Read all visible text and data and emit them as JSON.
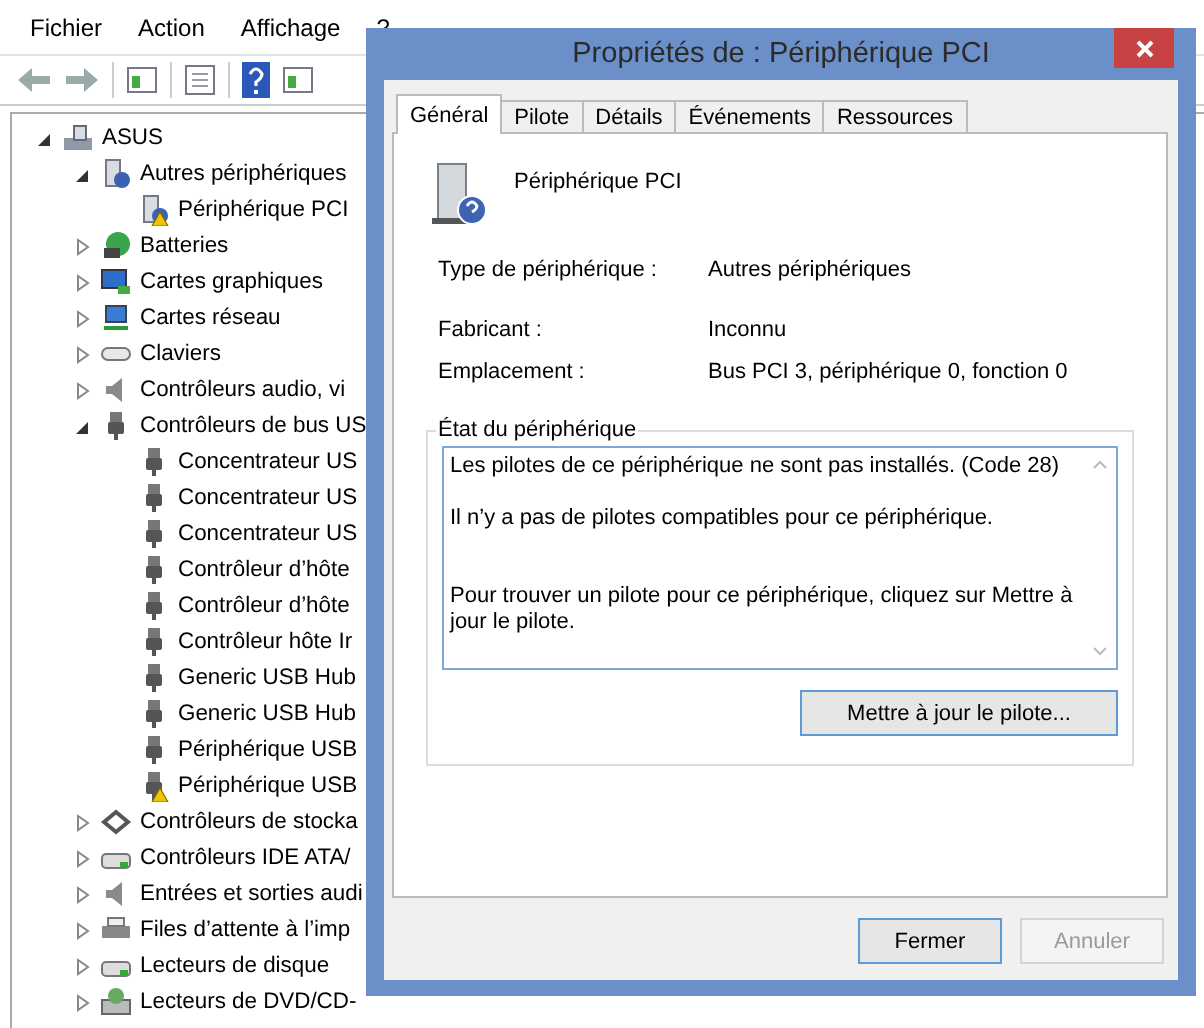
{
  "menu": [
    "Fichier",
    "Action",
    "Affichage",
    "?"
  ],
  "tree": [
    {
      "label": "ASUS",
      "kind": "computer",
      "expanded": true,
      "children": [
        {
          "label": "Autres périphériques",
          "kind": "unknown",
          "expanded": true,
          "children": [
            {
              "label": "Périphérique PCI",
              "kind": "unknown",
              "warning": true
            }
          ]
        },
        {
          "label": "Batteries",
          "kind": "battery",
          "expanded": false
        },
        {
          "label": "Cartes graphiques",
          "kind": "display",
          "expanded": false
        },
        {
          "label": "Cartes réseau",
          "kind": "network",
          "expanded": false
        },
        {
          "label": "Claviers",
          "kind": "keyboard",
          "expanded": false
        },
        {
          "label": "Contrôleurs audio, vi",
          "kind": "audio",
          "expanded": false
        },
        {
          "label": "Contrôleurs de bus US",
          "kind": "usb",
          "expanded": true,
          "children": [
            {
              "label": "Concentrateur US",
              "kind": "usb",
              "warning": false
            },
            {
              "label": "Concentrateur US",
              "kind": "usb",
              "warning": false
            },
            {
              "label": "Concentrateur US",
              "kind": "usb",
              "warning": false
            },
            {
              "label": "Contrôleur d’hôte",
              "kind": "usb",
              "warning": false
            },
            {
              "label": "Contrôleur d’hôte",
              "kind": "usb",
              "warning": false
            },
            {
              "label": "Contrôleur hôte Ir",
              "kind": "usb",
              "warning": false
            },
            {
              "label": "Generic USB Hub",
              "kind": "usb",
              "warning": false
            },
            {
              "label": "Generic USB Hub",
              "kind": "usb",
              "warning": false
            },
            {
              "label": "Périphérique USB",
              "kind": "usb",
              "warning": false
            },
            {
              "label": "Périphérique USB",
              "kind": "usb",
              "warning": true
            }
          ]
        },
        {
          "label": "Contrôleurs de stocka",
          "kind": "storage",
          "expanded": false
        },
        {
          "label": "Contrôleurs IDE ATA/",
          "kind": "disk",
          "expanded": false
        },
        {
          "label": "Entrées et sorties audi",
          "kind": "audio",
          "expanded": false
        },
        {
          "label": "Files d’attente à l’imp",
          "kind": "printer",
          "expanded": false
        },
        {
          "label": "Lecteurs de disque",
          "kind": "disk",
          "expanded": false
        },
        {
          "label": "Lecteurs de DVD/CD-",
          "kind": "dvd",
          "expanded": false
        }
      ]
    }
  ],
  "dialog": {
    "title": "Propriétés de : Périphérique PCI",
    "tabs": [
      {
        "label": "Général",
        "selected": true
      },
      {
        "label": "Pilote",
        "selected": false
      },
      {
        "label": "Détails",
        "selected": false
      },
      {
        "label": "Événements",
        "selected": false
      },
      {
        "label": "Ressources",
        "selected": false
      }
    ],
    "device_name": "Périphérique PCI",
    "properties": [
      {
        "label": "Type de périphérique :",
        "value": "Autres périphériques"
      },
      {
        "label": "Fabricant :",
        "value": "Inconnu"
      },
      {
        "label": "Emplacement :",
        "value": "Bus PCI 3, périphérique 0, fonction 0"
      }
    ],
    "status_group": "État du périphérique",
    "status_lines": [
      "Les pilotes de ce périphérique ne sont pas installés. (Code 28)",
      "Il n’y a pas de pilotes compatibles pour ce périphérique.",
      "Pour trouver un pilote pour ce périphérique, cliquez sur Mettre à jour le pilote."
    ],
    "update_button": "Mettre à jour le pilote...",
    "buttons": [
      {
        "label": "Fermer",
        "disabled": false
      },
      {
        "label": "Annuler",
        "disabled": true
      }
    ]
  }
}
